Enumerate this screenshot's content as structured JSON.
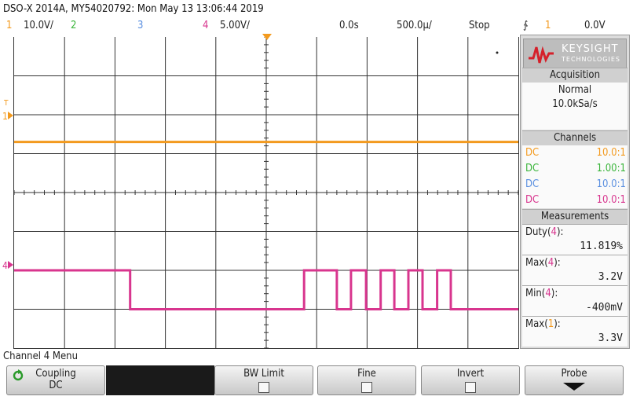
{
  "header": {
    "title": "DSO-X 2014A, MY54020792: Mon May 13 13:06:44 2019",
    "ch1_num": "1",
    "ch1_scale": "10.0V/",
    "ch2_num": "2",
    "ch3_num": "3",
    "ch4_num": "4",
    "ch4_scale": "5.00V/",
    "time_delay": "0.0s",
    "time_scale": "500.0µ/",
    "run_state": "Stop",
    "trigger_icon": "∱",
    "trigger_source": "1",
    "trigger_level": "0.0V"
  },
  "markers": {
    "ch1_label": "1",
    "ch4_label": "4",
    "trig_level_label": "T"
  },
  "panel": {
    "logo_brand": "KEYSIGHT",
    "logo_sub": "TECHNOLOGIES",
    "acquisition_title": "Acquisition",
    "acquisition_mode": "Normal",
    "sample_rate": "10.0kSa/s",
    "channels_title": "Channels",
    "channels": [
      {
        "coupling": "DC",
        "probe": "10.0:1",
        "color": "#f39a1e"
      },
      {
        "coupling": "DC",
        "probe": "1.00:1",
        "color": "#3bb53b"
      },
      {
        "coupling": "DC",
        "probe": "10.0:1",
        "color": "#5a8fe0"
      },
      {
        "coupling": "DC",
        "probe": "10.0:1",
        "color": "#d8358e"
      }
    ],
    "measurements_title": "Measurements",
    "measurements": [
      {
        "label": "Duty",
        "source": "4",
        "source_color": "#d8358e",
        "value": "11.819%"
      },
      {
        "label": "Max",
        "source": "4",
        "source_color": "#d8358e",
        "value": "3.2V"
      },
      {
        "label": "Min",
        "source": "4",
        "source_color": "#d8358e",
        "value": "-400mV"
      },
      {
        "label": "Max",
        "source": "1",
        "source_color": "#f39a1e",
        "value": "3.3V"
      }
    ]
  },
  "menu": {
    "title": "Channel 4 Menu",
    "softkeys": [
      {
        "label": "Coupling",
        "value": "DC"
      },
      {
        "label": "BW Limit"
      },
      {
        "label": "Fine"
      },
      {
        "label": "Invert"
      },
      {
        "label": "Probe"
      }
    ]
  },
  "colors": {
    "ch1": "#f39a1e",
    "ch2": "#3bb53b",
    "ch3": "#5a8fe0",
    "ch4": "#d8358e",
    "grid": "#333333"
  },
  "icons": {
    "coupling_cycle": "cycle-arrow-icon",
    "probe_expand": "down-arrow-icon",
    "logo": "keysight-wave-icon"
  },
  "chart_data": {
    "type": "line",
    "x_divisions": 10,
    "y_divisions": 8,
    "series": [
      {
        "name": "1",
        "color": "#f39a1e",
        "x": [
          0,
          10
        ],
        "y_div": [
          -1.3,
          -1.3
        ]
      },
      {
        "name": "4",
        "color": "#d8358e",
        "x": [
          0,
          2.3,
          2.3,
          5.75,
          5.75,
          6.4,
          6.4,
          6.68,
          6.68,
          6.98,
          6.98,
          7.27,
          7.27,
          7.54,
          7.54,
          7.82,
          7.82,
          8.1,
          8.1,
          8.39,
          8.39,
          8.66,
          8.66,
          10
        ],
        "y_div": [
          2.0,
          2.0,
          3.0,
          3.0,
          2.0,
          2.0,
          3.0,
          3.0,
          2.0,
          2.0,
          3.0,
          3.0,
          2.0,
          2.0,
          3.0,
          3.0,
          2.0,
          2.0,
          3.0,
          3.0,
          2.0,
          2.0,
          3.0,
          3.0
        ]
      }
    ]
  }
}
